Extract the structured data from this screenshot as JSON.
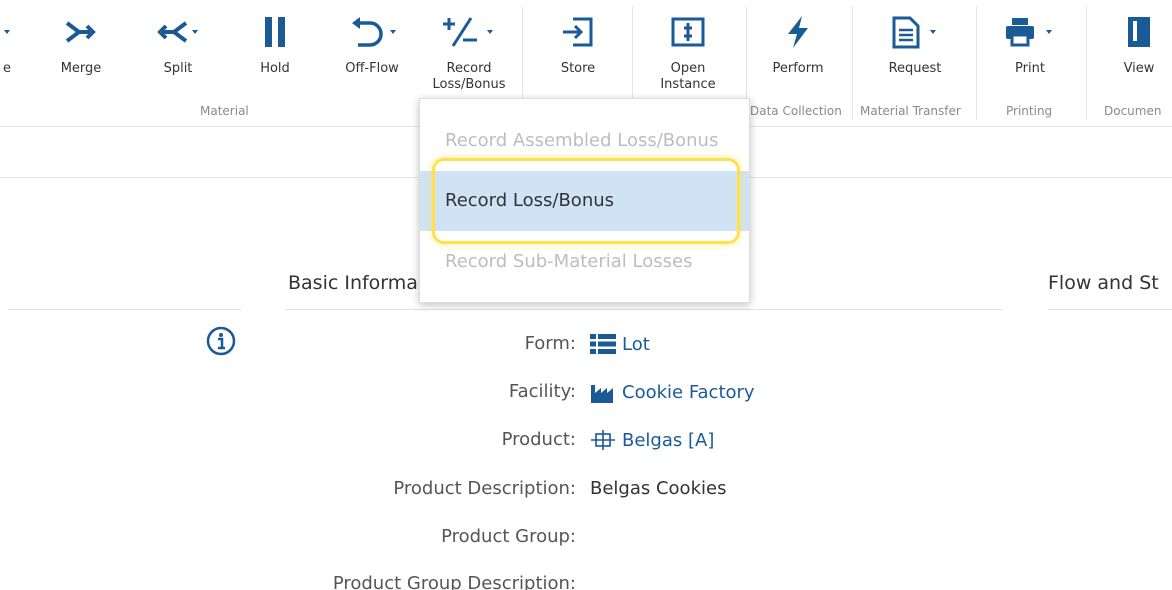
{
  "ribbon": {
    "partial_left_label": "e",
    "buttons": {
      "merge": "Merge",
      "split": "Split",
      "hold": "Hold",
      "offflow": "Off-Flow",
      "record": "Record\nLoss/Bonus",
      "store": "Store",
      "open_instance": "Open\nInstance",
      "perform": "Perform",
      "request": "Request",
      "print": "Print",
      "view": "View"
    },
    "groups": {
      "material": "Material",
      "data_collection": "Data Collection",
      "material_transfer": "Material Transfer",
      "printing": "Printing",
      "documents": "Documen"
    }
  },
  "dropdown": {
    "items": [
      {
        "label": "Record Assembled Loss/Bonus",
        "enabled": false
      },
      {
        "label": "Record Loss/Bonus",
        "enabled": true
      },
      {
        "label": "Record Sub-Material Losses",
        "enabled": false
      }
    ]
  },
  "sections": {
    "basic_info_title": "Basic Informa",
    "flow_title": "Flow and St"
  },
  "fields": [
    {
      "label": "Form:",
      "value": "Lot",
      "icon": "list-icon",
      "link": true
    },
    {
      "label": "Facility:",
      "value": "Cookie Factory",
      "icon": "factory-icon",
      "link": true
    },
    {
      "label": "Product:",
      "value": "Belgas [A]",
      "icon": "product-icon",
      "link": true
    },
    {
      "label": "Product Description:",
      "value": "Belgas Cookies",
      "icon": "",
      "link": false
    },
    {
      "label": "Product Group:",
      "value": "",
      "icon": "",
      "link": false
    },
    {
      "label": "Product Group Description:",
      "value": "",
      "icon": "",
      "link": false
    }
  ],
  "colors": {
    "accent": "#1a5a96",
    "highlight": "#ffe14a",
    "selected": "#cfe3f4"
  }
}
